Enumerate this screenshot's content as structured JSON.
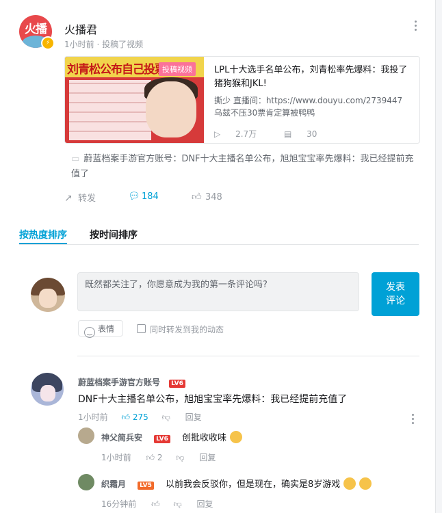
{
  "post": {
    "author": "火播君",
    "avatar_text": "火播",
    "meta": "1小时前 · 投稿了视频",
    "video": {
      "thumb_title": "刘青松公布自己投票名单",
      "tag": "投稿视频",
      "title": "LPL十大选手名单公布，刘青松率先爆料：我投了猪狗猴和JKL!",
      "desc": "撕少 直播间：https://www.douyu.com/2739447 乌兹不压30票肯定算被鸭鸭",
      "views": "2.7万",
      "danmaku": "30"
    },
    "quote_name": "蔚蓝档案手游官方账号",
    "quote_text": "：DNF十大主播名单公布，旭旭宝宝率先爆料：我已经提前充值了",
    "actions": {
      "share": "转发",
      "comments": "184",
      "likes": "348"
    }
  },
  "tabs": {
    "hot": "按热度排序",
    "time": "按时间排序"
  },
  "composer": {
    "placeholder": "既然都关注了，你愿意成为我的第一条评论吗?",
    "post_btn_1": "发表",
    "post_btn_2": "评论",
    "emoji": "表情",
    "repost_label": "同时转发到我的动态"
  },
  "comments": [
    {
      "name": "蔚蓝档案手游官方账号",
      "level": "LV6",
      "text": "DNF十大主播名单公布，旭旭宝宝率先爆料：我已经提前充值了",
      "time": "1小时前",
      "likes": "275",
      "reply": "回复",
      "replies": [
        {
          "name": "神父简兵安",
          "level": "LV6",
          "text": "创批收收味",
          "time": "1小时前",
          "likes": "2",
          "reply": "回复"
        },
        {
          "name": "织霜月",
          "level": "LV5",
          "text": "以前我会反驳你，但是现在，确实是8岁游戏",
          "time": "16分钟前",
          "likes": "",
          "reply": "回复"
        }
      ]
    }
  ],
  "colors": {
    "accent": "#00a1d6",
    "tag": "#fb7299",
    "level": "#f04c49"
  }
}
